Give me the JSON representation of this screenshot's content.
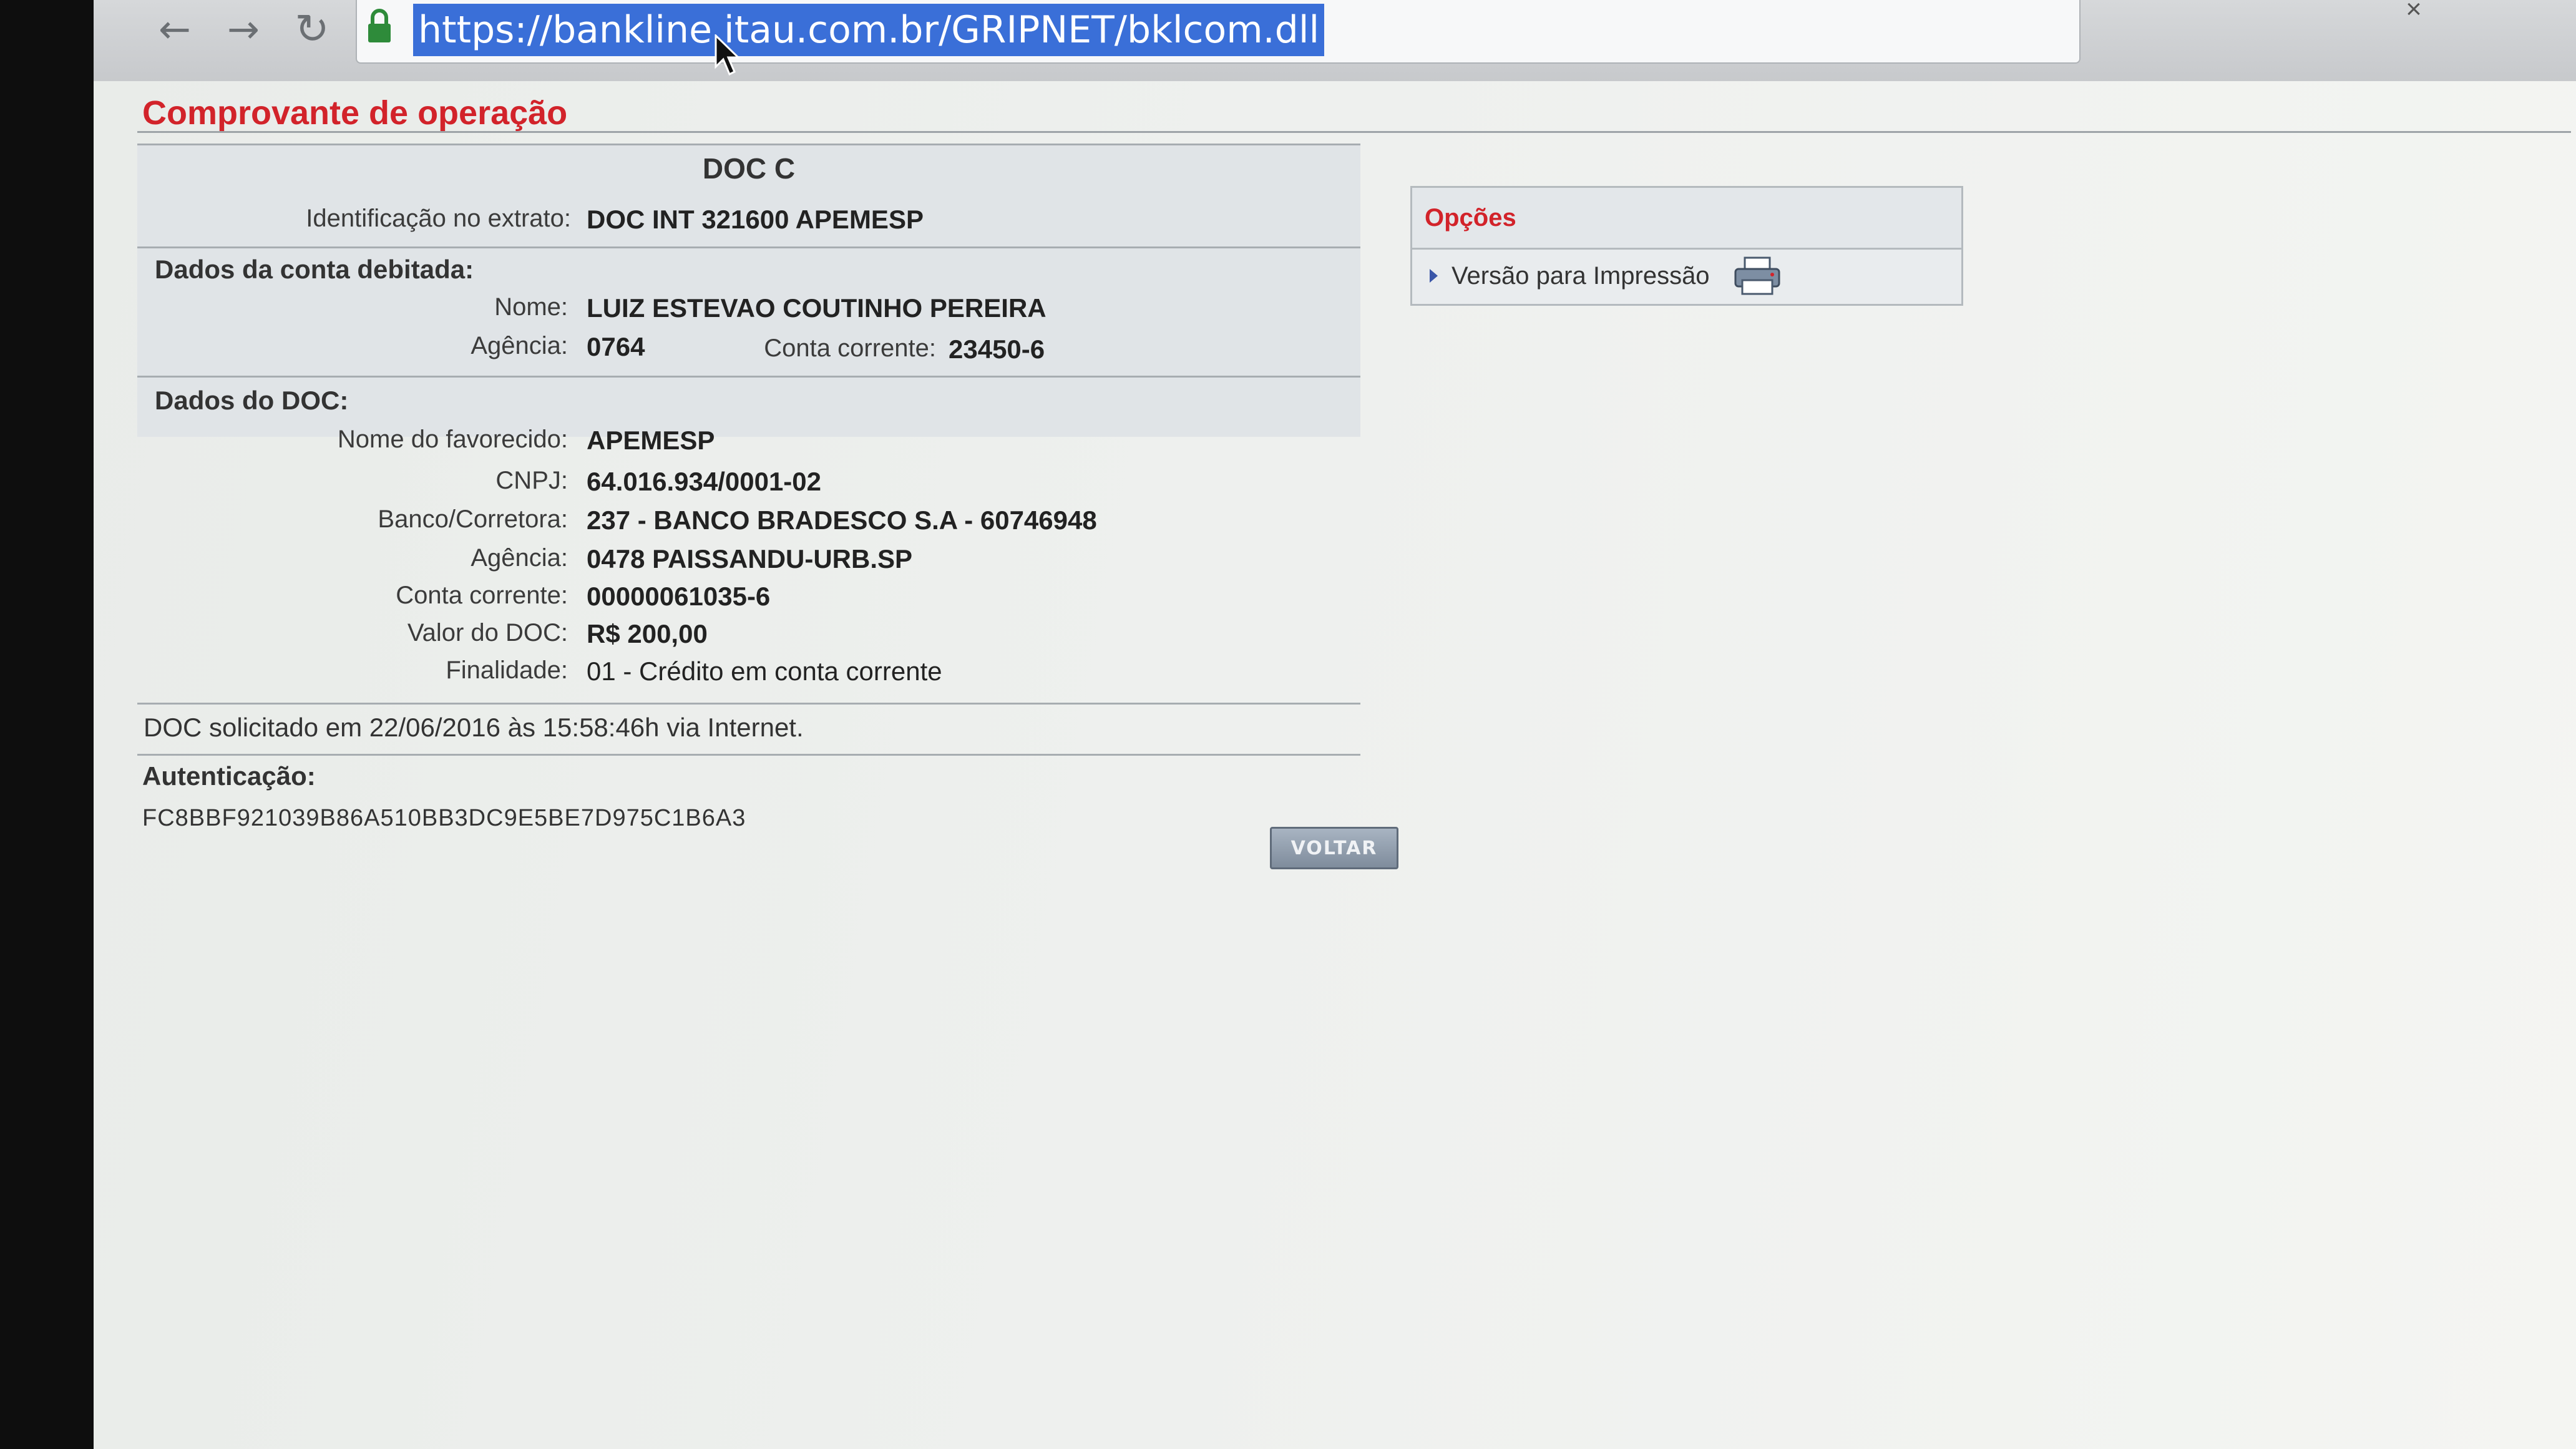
{
  "browser": {
    "url": "https://bankline.itau.com.br/GRIPNET/bklcom.dll"
  },
  "page": {
    "title": "Comprovante de operação"
  },
  "receipt": {
    "heading": "DOC C",
    "statement_id": {
      "label": "Identificação no extrato:",
      "value": "DOC INT 321600 APEMESP"
    },
    "debit_section": "Dados da conta debitada:",
    "debit": {
      "name_label": "Nome:",
      "name": "LUIZ ESTEVAO COUTINHO PEREIRA",
      "agency_label": "Agência:",
      "agency": "0764",
      "account_label": "Conta corrente:",
      "account": "23450-6"
    },
    "doc_section": "Dados do DOC:",
    "doc": {
      "payee_label": "Nome do favorecido:",
      "payee": "APEMESP",
      "cnpj_label": "CNPJ:",
      "cnpj": "64.016.934/0001-02",
      "bank_label": "Banco/Corretora:",
      "bank": "237 - BANCO BRADESCO S.A - 60746948",
      "agency_label": "Agência:",
      "agency": "0478 PAISSANDU-URB.SP",
      "account_label": "Conta corrente:",
      "account": "00000061035-6",
      "amount_label": "Valor do DOC:",
      "amount": "R$ 200,00",
      "purpose_label": "Finalidade:",
      "purpose": "01 - Crédito em conta corrente"
    },
    "requested": "DOC solicitado em 22/06/2016 às 15:58:46h via Internet.",
    "auth_label": "Autenticação:",
    "auth_code": "FC8BBF921039B86A510BB3DC9E5BE7D975C1B6A3",
    "back_button": "VOLTAR"
  },
  "options": {
    "title": "Opções",
    "print_link": "Versão para Impressão"
  },
  "colors": {
    "accent_red": "#d2232a",
    "url_highlight": "#3a6fd8"
  }
}
